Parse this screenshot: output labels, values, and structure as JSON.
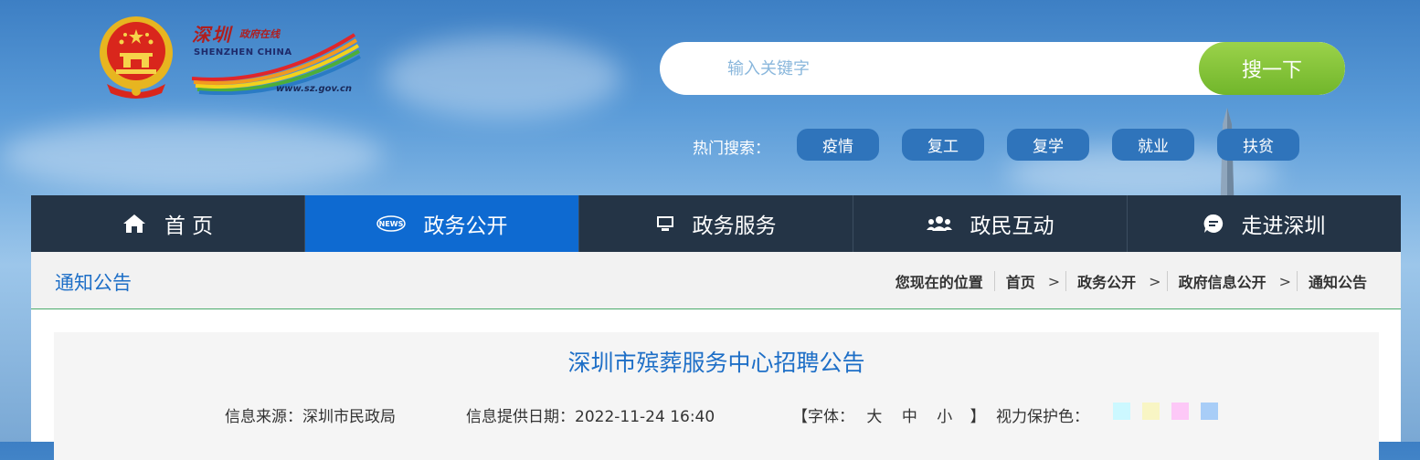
{
  "logo": {
    "cn_city": "深圳",
    "cn_sub": "政府在线",
    "en": "SHENZHEN CHINA",
    "url": "www.sz.gov.cn"
  },
  "search": {
    "placeholder": "输入关键字",
    "button": "搜一下"
  },
  "hot": {
    "label": "热门搜索：",
    "tags": [
      "疫情",
      "复工",
      "复学",
      "就业",
      "扶贫"
    ]
  },
  "nav": {
    "items": [
      {
        "label": "首 页",
        "icon": "home-icon"
      },
      {
        "label": "政务公开",
        "icon": "news-icon",
        "active": true
      },
      {
        "label": "政务服务",
        "icon": "monitor-icon"
      },
      {
        "label": "政民互动",
        "icon": "users-icon"
      },
      {
        "label": "走进深圳",
        "icon": "chat-bubble-icon"
      }
    ]
  },
  "breadcrumb": {
    "section": "通知公告",
    "location_label": "您现在的位置",
    "items": [
      "首页",
      "政务公开",
      "政府信息公开",
      "通知公告"
    ],
    "separator": ">"
  },
  "article": {
    "title": "深圳市殡葬服务中心招聘公告",
    "source": "信息来源：深圳市民政局",
    "date": "信息提供日期：2022-11-24 16:40",
    "font_open": "【字体：",
    "font_large": "大",
    "font_medium": "中",
    "font_small": "小",
    "font_close": "】",
    "eye_care": "视力保护色：",
    "eye_colors": [
      "#ccf8ff",
      "#f8f5c4",
      "#fdc8f7",
      "#a8cdf7"
    ]
  },
  "colors": {
    "nav_bg": "#243446",
    "nav_active": "#0e6ad1",
    "accent_blue": "#1e6fc7",
    "search_btn": "#80c235"
  }
}
